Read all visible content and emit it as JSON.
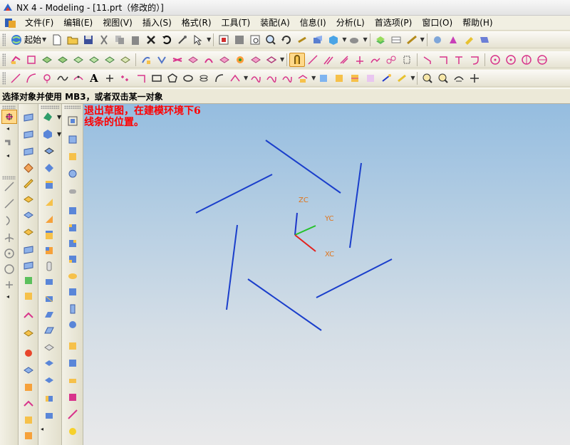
{
  "window": {
    "title": "NX 4 - Modeling - [11.prt（修改的）]"
  },
  "menu": [
    "文件(F)",
    "编辑(E)",
    "视图(V)",
    "插入(S)",
    "格式(R)",
    "工具(T)",
    "装配(A)",
    "信息(I)",
    "分析(L)",
    "首选项(P)",
    "窗口(O)",
    "帮助(H)"
  ],
  "toolbar": {
    "start_label": "起始",
    "text_tool_glyph": "A"
  },
  "status": {
    "prompt": "选择对象并使用 MB3，或者双击某一对象"
  },
  "viewport": {
    "cue": "退出草图，在建模环境下6\n线条的位置。",
    "triad": {
      "zc": "ZC",
      "yc": "YC",
      "xc": "XC"
    }
  },
  "colors": {
    "sketch_line": "#1a3ecb",
    "axis_x": "#e4201c",
    "axis_y": "#24c22a",
    "axis_z": "#1e36c9",
    "triad_label": "#e0741a",
    "cue_text": "#ff0000"
  },
  "icons": {
    "title": "nx-app-icon",
    "menubar": "nx-menubar-icon",
    "toolbar1": [
      "start-globe-icon",
      "new-file-icon",
      "open-file-icon",
      "save-icon",
      "cut-icon",
      "copy-icon",
      "paste-icon",
      "delete-icon",
      "undo-icon",
      "repeat-command-icon",
      "selection-filter-icon",
      "fit-view-icon",
      "zoom-window-icon",
      "zoom-icon",
      "rotate-icon",
      "pan-icon",
      "perspective-icon",
      "render-style-icon",
      "view-orient-icon",
      "layer-settings-icon",
      "work-layer-icon",
      "measure-icon",
      "analysis-icon",
      "snap-point-icon",
      "highlight-icon"
    ],
    "toolbar2": [
      "sketch-finish-icon",
      "sketch-plane-icon",
      "extrude-icon",
      "revolve-icon",
      "sweep-icon",
      "trim-body-icon",
      "blend-icon",
      "sew-icon",
      "offset-surface-icon",
      "thicken-icon",
      "intersection-icon",
      "project-curve-icon",
      "join-curve-icon",
      "bridge-curve-icon",
      "section-icon",
      "snap-lock-icon",
      "line-tool-icon",
      "arc-tool-icon",
      "constraint-parallel-icon",
      "constraint-perpendicular-icon",
      "dimension-icon",
      "curve-derive-icon",
      "quick-trim-icon",
      "quick-extend-icon",
      "corner-icon",
      "make-corner-icon",
      "fillet-icon",
      "circle-icon",
      "point-icon"
    ],
    "toolbar3": [
      "line-icon",
      "arc-icon",
      "circle-3pt-icon",
      "spline-icon",
      "studio-spline-icon",
      "text-icon",
      "point-set-icon",
      "polyline-icon",
      "rectangle-icon",
      "polygon-icon",
      "ellipse-icon",
      "helix-icon",
      "conic-icon",
      "offset-curve-icon",
      "combined-curve-icon",
      "extract-curve-icon",
      "isoparametric-icon",
      "mirror-curve-icon",
      "scale-curve-icon",
      "wrap-curve-icon",
      "trim-curve-icon",
      "divide-curve-icon",
      "join-icon",
      "edit-param-icon",
      "measure-distance-icon",
      "measure-angle-icon",
      "curve-analysis-icon",
      "deviation-icon"
    ]
  }
}
